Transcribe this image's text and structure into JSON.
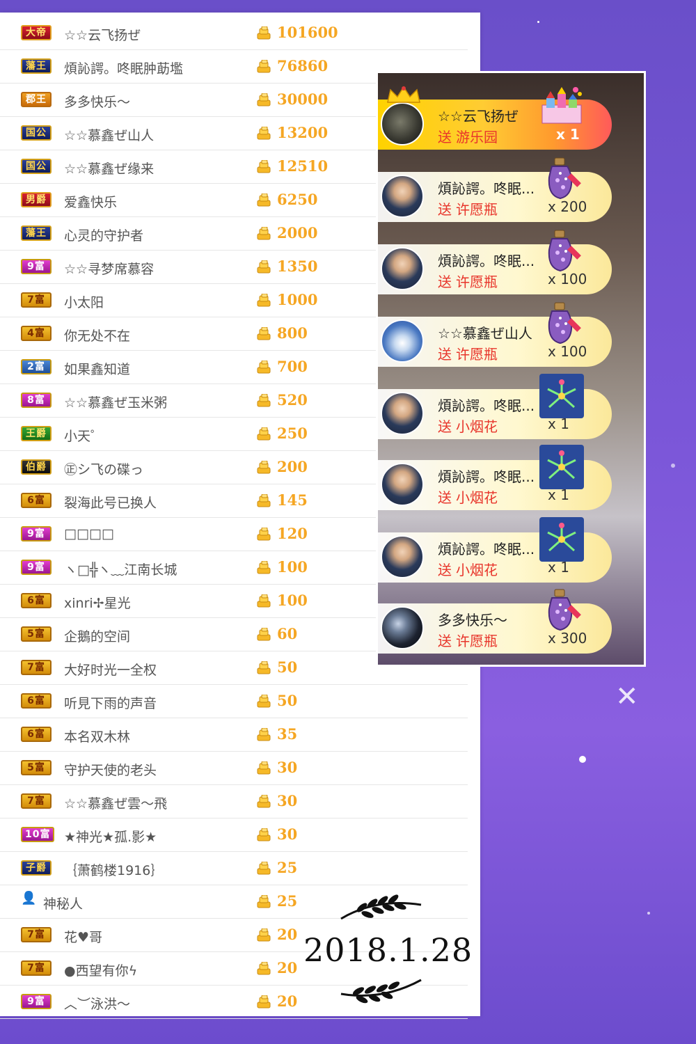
{
  "leaderboard": [
    {
      "badge": "大帝",
      "badge_style": "b-red",
      "name": "☆☆云飞扬ぜ",
      "score": "101600"
    },
    {
      "badge": "藩王",
      "badge_style": "b-blue",
      "name": "煩訫諤。咚眠肿莇壏",
      "score": "76860"
    },
    {
      "badge": "郡王",
      "badge_style": "b-orange",
      "name": "多多快乐～",
      "score": "30000"
    },
    {
      "badge": "国公",
      "badge_style": "b-blue",
      "name": "☆☆慕鑫ぜ山人",
      "score": "13200"
    },
    {
      "badge": "国公",
      "badge_style": "b-blue",
      "name": "☆☆慕鑫ぜ缘来",
      "score": "12510"
    },
    {
      "badge": "男爵",
      "badge_style": "b-red",
      "name": "爱鑫快乐",
      "score": "6250"
    },
    {
      "badge": "藩王",
      "badge_style": "b-blue",
      "name": "心灵的守护者",
      "score": "2000"
    },
    {
      "badge": "9富",
      "badge_style": "b-magenta",
      "name": "☆☆寻梦席慕容",
      "score": "1350"
    },
    {
      "badge": "7富",
      "badge_style": "b-gold",
      "name": "小太阳",
      "score": "1000"
    },
    {
      "badge": "4富",
      "badge_style": "b-gold",
      "name": "你无处不在",
      "score": "800"
    },
    {
      "badge": "2富",
      "badge_style": "b-teal",
      "name": "如果鑫知道",
      "score": "700"
    },
    {
      "badge": "8富",
      "badge_style": "b-magenta",
      "name": "☆☆慕鑫ぜ玉米粥",
      "score": "520"
    },
    {
      "badge": "王爵",
      "badge_style": "b-green",
      "name": "小天゜",
      "score": "250"
    },
    {
      "badge": "伯爵",
      "badge_style": "b-dark",
      "name": "㊣シ飞の碟っ",
      "score": "200"
    },
    {
      "badge": "6富",
      "badge_style": "b-gold",
      "name": "裂海此号已换人",
      "score": "145"
    },
    {
      "badge": "9富",
      "badge_style": "b-magenta",
      "name": "□□□□",
      "score": "120"
    },
    {
      "badge": "9富",
      "badge_style": "b-magenta",
      "name": "ヽ□╬ヽ﹏江南长城",
      "score": "100"
    },
    {
      "badge": "6富",
      "badge_style": "b-gold",
      "name": "xinri✢星光",
      "score": "100"
    },
    {
      "badge": "5富",
      "badge_style": "b-gold",
      "name": "企鵝的空间",
      "score": "60"
    },
    {
      "badge": "7富",
      "badge_style": "b-gold",
      "name": "大好时光一全权",
      "score": "50"
    },
    {
      "badge": "6富",
      "badge_style": "b-gold",
      "name": "听見下雨的声音",
      "score": "50"
    },
    {
      "badge": "6富",
      "badge_style": "b-gold",
      "name": "本名双木林",
      "score": "35"
    },
    {
      "badge": "5富",
      "badge_style": "b-gold",
      "name": "守护天使的老头",
      "score": "30"
    },
    {
      "badge": "7富",
      "badge_style": "b-gold",
      "name": "☆☆慕鑫ぜ雲～飛",
      "score": "30"
    },
    {
      "badge": "10富",
      "badge_style": "b-magenta",
      "name": "★神光★孤.影★",
      "score": "30"
    },
    {
      "badge": "子爵",
      "badge_style": "b-blue",
      "name": "｛萧鹤楼1916｝",
      "score": "25"
    },
    {
      "badge": "",
      "badge_style": "b-mystery",
      "name": "神秘人",
      "score": "25"
    },
    {
      "badge": "7富",
      "badge_style": "b-gold",
      "name": "花♥哥",
      "score": "20"
    },
    {
      "badge": "7富",
      "badge_style": "b-gold",
      "name": "●西望有你ϟ",
      "score": "20"
    },
    {
      "badge": "9富",
      "badge_style": "b-magenta",
      "name": "︿︶泳洪～",
      "score": "20"
    }
  ],
  "gifts": [
    {
      "name": "☆☆云飞扬ぜ",
      "verb": "送",
      "gift": "游乐园",
      "count": "x 1",
      "gift_icon": "amusement-park-icon",
      "avatar": "avatar-dark",
      "top": true
    },
    {
      "name": "煩訫諤。咚眠...",
      "verb": "送",
      "gift": "许愿瓶",
      "count": "x 200",
      "gift_icon": "wish-bottle-icon",
      "avatar": "avatar-man",
      "top": false
    },
    {
      "name": "煩訫諤。咚眠...",
      "verb": "送",
      "gift": "许愿瓶",
      "count": "x 100",
      "gift_icon": "wish-bottle-icon",
      "avatar": "avatar-man",
      "top": false
    },
    {
      "name": "☆☆慕鑫ぜ山人",
      "verb": "送",
      "gift": "许愿瓶",
      "count": "x 100",
      "gift_icon": "wish-bottle-icon",
      "avatar": "avatar-sky",
      "top": false
    },
    {
      "name": "煩訫諤。咚眠...",
      "verb": "送",
      "gift": "小烟花",
      "count": "x 1",
      "gift_icon": "firework-icon",
      "avatar": "avatar-man",
      "top": false
    },
    {
      "name": "煩訫諤。咚眠...",
      "verb": "送",
      "gift": "小烟花",
      "count": "x 1",
      "gift_icon": "firework-icon",
      "avatar": "avatar-man",
      "top": false
    },
    {
      "name": "煩訫諤。咚眠...",
      "verb": "送",
      "gift": "小烟花",
      "count": "x 1",
      "gift_icon": "firework-icon",
      "avatar": "avatar-man",
      "top": false
    },
    {
      "name": "多多快乐～",
      "verb": "送",
      "gift": "许愿瓶",
      "count": "x 300",
      "gift_icon": "wish-bottle-icon",
      "avatar": "avatar-planet",
      "top": false
    }
  ],
  "date": "2018.1.28",
  "colors": {
    "score": "#f5a623",
    "gift_text": "#e8352b",
    "background": "#7a56d8"
  }
}
